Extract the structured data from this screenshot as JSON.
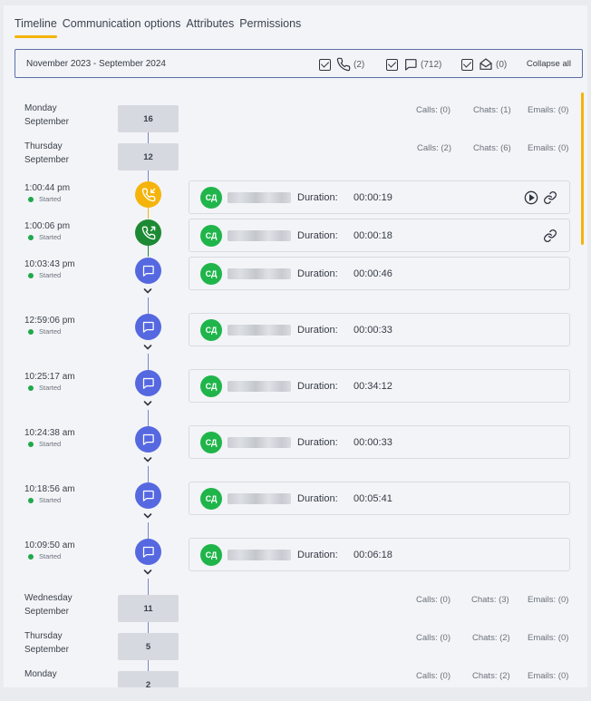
{
  "tabs": [
    {
      "label": "Timeline",
      "active": true
    },
    {
      "label": "Communication options",
      "active": false
    },
    {
      "label": "Attributes",
      "active": false
    },
    {
      "label": "Permissions",
      "active": false
    }
  ],
  "filter": {
    "date_range": "November 2023 - September 2024",
    "calls_count": "(2)",
    "chats_count": "(712)",
    "emails_count": "(0)",
    "collapse_label": "Collapse all"
  },
  "days": [
    {
      "weekday": "Monday",
      "month": "September",
      "date": "16",
      "calls": "Calls: (0)",
      "chats": "Chats: (1)",
      "emails": "Emails: (0)"
    },
    {
      "weekday": "Thursday",
      "month": "September",
      "date": "12",
      "calls": "Calls: (2)",
      "chats": "Chats: (6)",
      "emails": "Emails: (0)"
    },
    {
      "weekday": "Wednesday",
      "month": "September",
      "date": "11",
      "calls": "Calls: (0)",
      "chats": "Chats: (3)",
      "emails": "Emails: (0)"
    },
    {
      "weekday": "Thursday",
      "month": "September",
      "date": "5",
      "calls": "Calls: (0)",
      "chats": "Chats: (2)",
      "emails": "Emails: (0)"
    },
    {
      "weekday": "Monday",
      "month": "",
      "date": "2",
      "calls": "Calls: (0)",
      "chats": "Chats: (2)",
      "emails": "Emails: (0)"
    }
  ],
  "events": [
    {
      "time": "1:00:44 pm",
      "status": "Started",
      "type": "missed-call",
      "initials": "СД",
      "duration_label": "Duration:",
      "duration": "00:00:19",
      "actions": [
        "play",
        "link"
      ]
    },
    {
      "time": "1:00:06 pm",
      "status": "Started",
      "type": "outgoing-call",
      "initials": "СД",
      "duration_label": "Duration:",
      "duration": "00:00:18",
      "actions": [
        "link"
      ]
    },
    {
      "time": "10:03:43 pm",
      "status": "Started",
      "type": "chat",
      "initials": "СД",
      "duration_label": "Duration:",
      "duration": "00:00:46",
      "actions": []
    },
    {
      "time": "12:59:06 pm",
      "status": "Started",
      "type": "chat",
      "initials": "СД",
      "duration_label": "Duration:",
      "duration": "00:00:33",
      "actions": []
    },
    {
      "time": "10:25:17 am",
      "status": "Started",
      "type": "chat",
      "initials": "СД",
      "duration_label": "Duration:",
      "duration": "00:34:12",
      "actions": []
    },
    {
      "time": "10:24:38 am",
      "status": "Started",
      "type": "chat",
      "initials": "СД",
      "duration_label": "Duration:",
      "duration": "00:00:33",
      "actions": []
    },
    {
      "time": "10:18:56 am",
      "status": "Started",
      "type": "chat",
      "initials": "СД",
      "duration_label": "Duration:",
      "duration": "00:05:41",
      "actions": []
    },
    {
      "time": "10:09:50 am",
      "status": "Started",
      "type": "chat",
      "initials": "СД",
      "duration_label": "Duration:",
      "duration": "00:06:18",
      "actions": []
    }
  ],
  "colors": {
    "accent": "#f4b40b",
    "chat": "#5668e0",
    "missed_call": "#f4b40b",
    "outgoing_call": "#1c8a34",
    "avatar": "#1fb54a",
    "status": "#1fa94b"
  }
}
